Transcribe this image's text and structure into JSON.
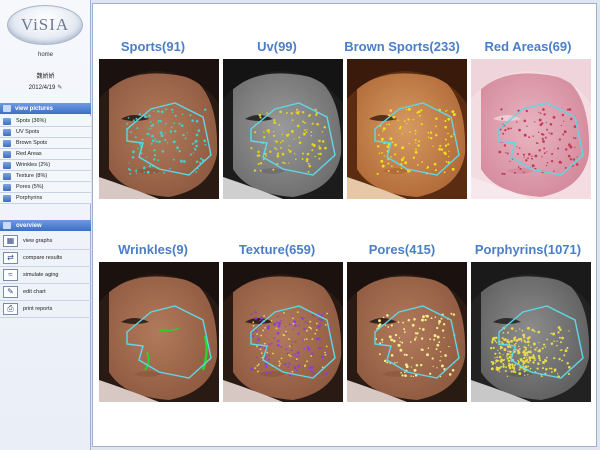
{
  "sidebar": {
    "logo_text": "ViSIA",
    "home_label": "home",
    "patient_name": "魏娇娇",
    "patient_date": "2012/4/19",
    "edit_glyph": "✎",
    "view_pictures_label": "view pictures",
    "sub_items": [
      {
        "label": "Spots (36%)"
      },
      {
        "label": "UV Spots"
      },
      {
        "label": "Brown Spots"
      },
      {
        "label": "Red Areas"
      },
      {
        "label": "Wrinkles (2%)"
      },
      {
        "label": "Texture (8%)"
      },
      {
        "label": "Pores (5%)"
      },
      {
        "label": "Porphyrins"
      }
    ],
    "overview_label": "overview",
    "tools": [
      {
        "label": "view graphs",
        "icon": "graph-icon",
        "glyph": "▦"
      },
      {
        "label": "compare results",
        "icon": "compare-icon",
        "glyph": "⇄"
      },
      {
        "label": "simulate aging",
        "icon": "aging-icon",
        "glyph": "≈"
      },
      {
        "label": "edit chart",
        "icon": "edit-chart-icon",
        "glyph": "✎"
      },
      {
        "label": "print reports",
        "icon": "printer-icon",
        "glyph": "⎙"
      }
    ]
  },
  "tiles": [
    {
      "title": "Sports(91)",
      "style": "normal",
      "dots": "#3fd1c8",
      "mode": "dots"
    },
    {
      "title": "Uv(99)",
      "style": "gray",
      "dots": "#e5d21c",
      "mode": "dots"
    },
    {
      "title": "Brown Sports(233)",
      "style": "brown",
      "dots": "#f0e21a",
      "mode": "dots"
    },
    {
      "title": "Red Areas(69)",
      "style": "red",
      "dots": "#c23a55",
      "mode": "dots"
    },
    {
      "title": "Wrinkles(9)",
      "style": "normal",
      "dots": "#27d62a",
      "mode": "lines"
    },
    {
      "title": "Texture(659)",
      "style": "normal",
      "dots": "#8a3fd6",
      "mode": "mixed"
    },
    {
      "title": "Pores(415)",
      "style": "normal",
      "dots": "#f3ef8a",
      "mode": "dots"
    },
    {
      "title": "Porphyrins(1071)",
      "style": "porph",
      "dots": "#e8dc4c",
      "mode": "dense"
    }
  ],
  "colors": {
    "title": "#4a7ec7",
    "nav_active": "#3d6fc8",
    "outline": "#5fd7e6"
  }
}
